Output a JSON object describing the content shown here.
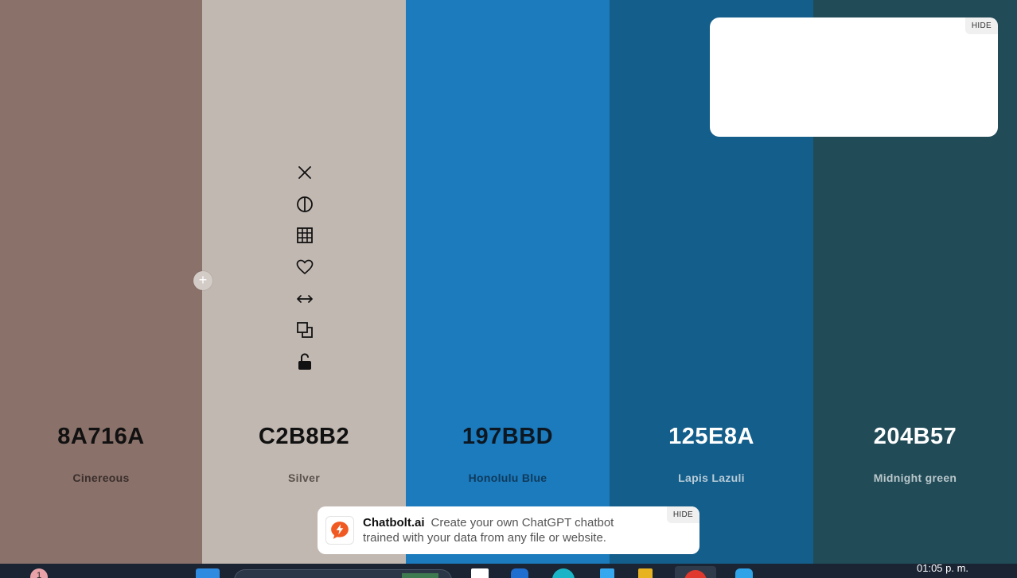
{
  "palette": {
    "swatches": [
      {
        "hex": "8A716A",
        "name": "Cinereous",
        "bg": "#8a716a",
        "hex_color": "#111111",
        "name_color": "#3a2f2c"
      },
      {
        "hex": "C2B8B2",
        "name": "Silver",
        "bg": "#c2b8b2",
        "hex_color": "#111111",
        "name_color": "#5b524d"
      },
      {
        "hex": "197BBD",
        "name": "Honolulu Blue",
        "bg": "#1b7bbd",
        "hex_color": "#0d1722",
        "name_color": "#0f3a5c"
      },
      {
        "hex": "125E8A",
        "name": "Lapis Lazuli",
        "bg": "#135e8a",
        "hex_color": "#ffffff",
        "name_color": "#b7cbd8"
      },
      {
        "hex": "204B57",
        "name": "Midnight green",
        "bg": "#214b57",
        "hex_color": "#ffffff",
        "name_color": "#b9c7cb"
      }
    ],
    "add_label": "+",
    "tools": [
      {
        "name": "remove-icon"
      },
      {
        "name": "contrast-icon"
      },
      {
        "name": "shades-grid-icon"
      },
      {
        "name": "heart-icon"
      },
      {
        "name": "drag-arrows-icon"
      },
      {
        "name": "copy-icon"
      },
      {
        "name": "unlock-icon"
      }
    ]
  },
  "ad": {
    "hide_label": "HIDE"
  },
  "banner": {
    "brand": "Chatbolt.ai",
    "text": "Create your own ChatGPT chatbot trained with your data from any file or website.",
    "hide_label": "HIDE",
    "accent": "#f05a22"
  },
  "taskbar": {
    "clock": "01:05 p. m.",
    "notification_count": "1"
  }
}
